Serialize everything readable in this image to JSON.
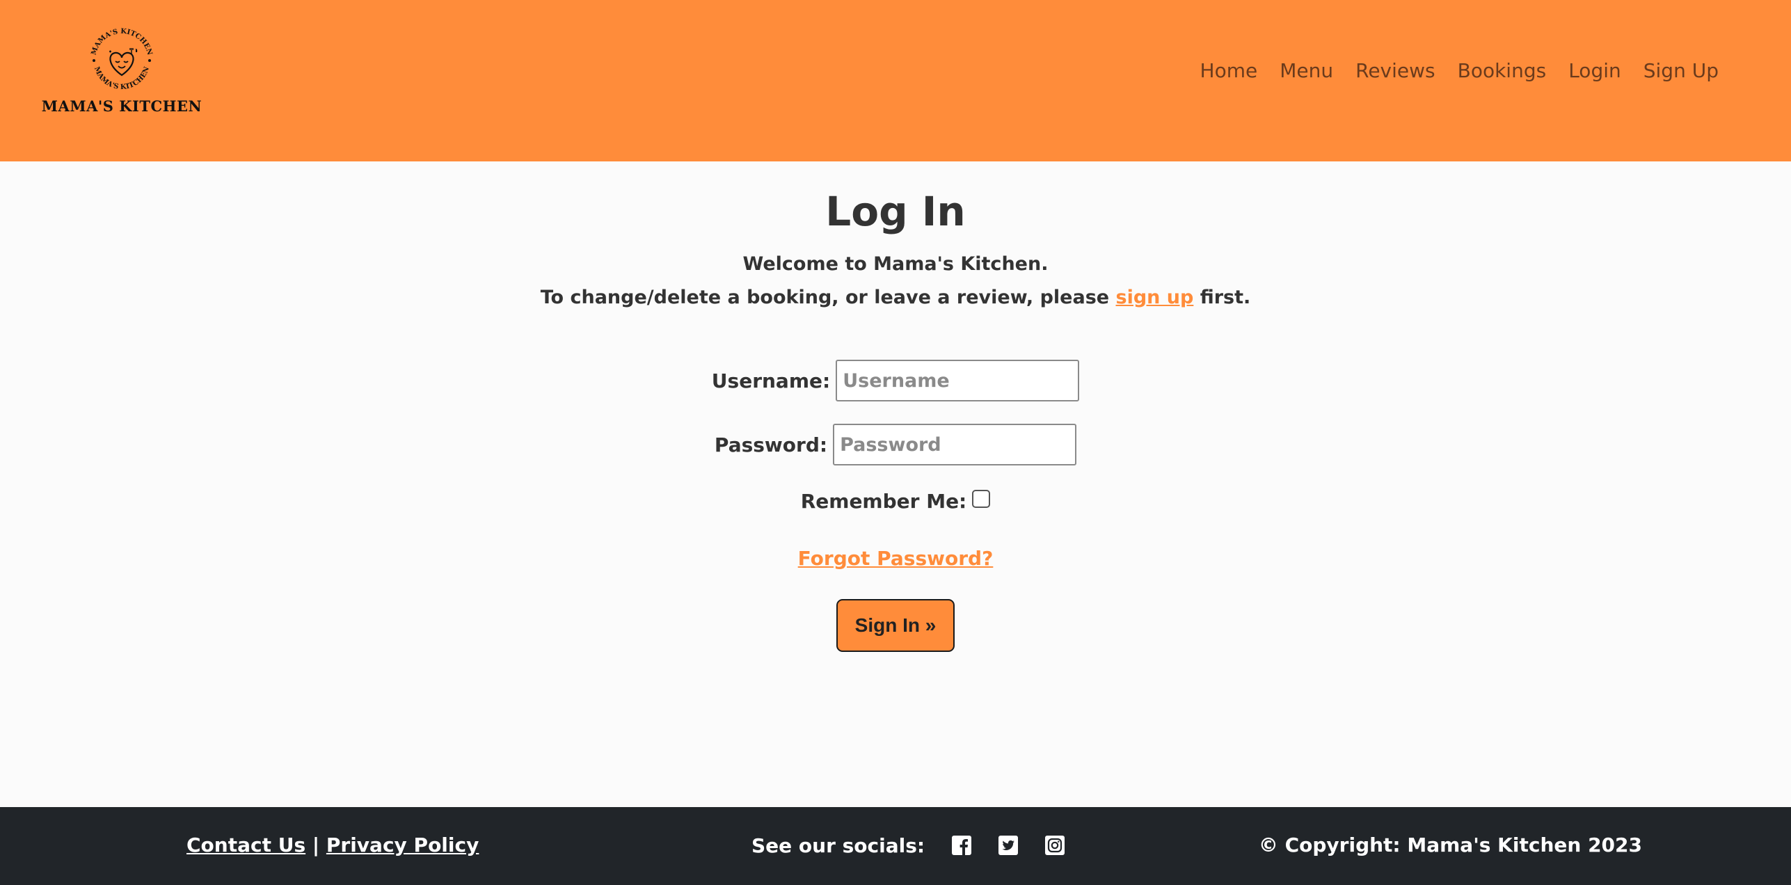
{
  "header": {
    "logo": {
      "arc_text": "MAMA'S KITCHEN",
      "name": "MAMA'S KITCHEN",
      "icon": "heart-face-logo"
    },
    "nav": [
      {
        "label": "Home"
      },
      {
        "label": "Menu"
      },
      {
        "label": "Reviews"
      },
      {
        "label": "Bookings"
      },
      {
        "label": "Login"
      },
      {
        "label": "Sign Up"
      }
    ]
  },
  "main": {
    "title": "Log In",
    "intro_line1": "Welcome to Mama's Kitchen.",
    "intro_line2_before": "To change/delete a booking, or leave a review, please ",
    "intro_line2_link": "sign up",
    "intro_line2_after": " first.",
    "form": {
      "username_label": "Username:",
      "username_placeholder": "Username",
      "username_value": "",
      "password_label": "Password:",
      "password_placeholder": "Password",
      "password_value": "",
      "remember_label": "Remember Me:",
      "remember_checked": false,
      "forgot_label": "Forgot Password?",
      "submit_label": "Sign In »"
    }
  },
  "footer": {
    "contact_label": "Contact Us",
    "separator": "|",
    "privacy_label": "Privacy Policy",
    "socials_label": "See our socials:",
    "social_icons": [
      "facebook-icon",
      "twitter-icon",
      "instagram-icon"
    ],
    "copyright": "© Copyright: Mama's Kitchen 2023"
  },
  "colors": {
    "brand_orange": "#ff8c3a",
    "footer_bg": "#212529",
    "text_dark": "#333333",
    "nav_text": "#6b3b1c"
  }
}
